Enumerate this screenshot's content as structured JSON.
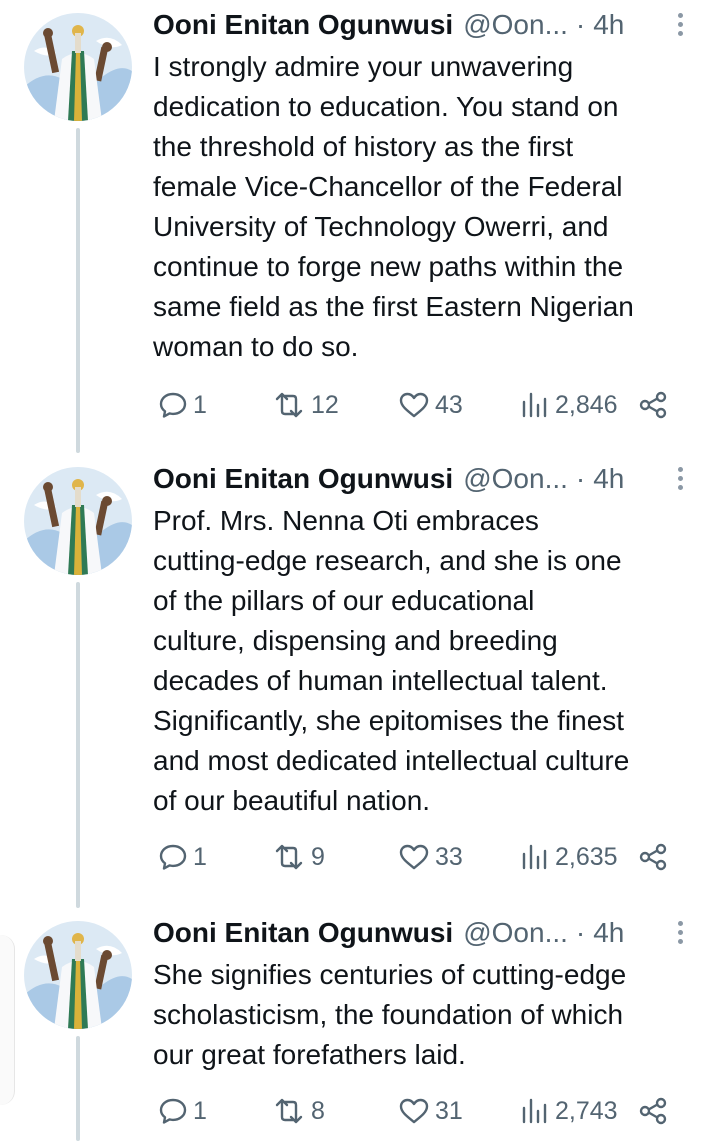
{
  "tweets": [
    {
      "author": "Ooni Enitan Ogunwusi",
      "handle": "@Oon...",
      "separator": "·",
      "time": "4h",
      "text": "I strongly admire your unwavering\ndedication to education. You stand on\nthe threshold of history as the first\nfemale Vice-Chancellor of the Federal\nUniversity of Technology Owerri, and\ncontinue to forge new paths within the\nsame field as the first Eastern Nigerian\nwoman to do so.",
      "replies": "1",
      "retweets": "12",
      "likes": "43",
      "views": "2,846"
    },
    {
      "author": "Ooni Enitan Ogunwusi",
      "handle": "@Oon...",
      "separator": "·",
      "time": "4h",
      "text": "Prof. Mrs. Nenna Oti embraces\ncutting-edge research, and she is one\nof the pillars of our educational\nculture, dispensing and breeding\ndecades of human intellectual talent.\nSignificantly, she epitomises the finest\nand most dedicated intellectual culture\nof our beautiful nation.",
      "replies": "1",
      "retweets": "9",
      "likes": "33",
      "views": "2,635"
    },
    {
      "author": "Ooni Enitan Ogunwusi",
      "handle": "@Oon...",
      "separator": "·",
      "time": "4h",
      "text": "She signifies centuries of cutting-edge\nscholasticism, the foundation of which\nour great forefathers laid.",
      "replies": "1",
      "retweets": "8",
      "likes": "31",
      "views": "2,743"
    }
  ],
  "icons": {
    "reply": "reply-icon",
    "retweet": "retweet-icon",
    "like": "heart-icon",
    "views": "views-icon",
    "share": "share-icon",
    "more": "more-options-icon"
  },
  "colors": {
    "text": "#0f1419",
    "muted": "#536471",
    "thread_line": "#cfd9de"
  }
}
